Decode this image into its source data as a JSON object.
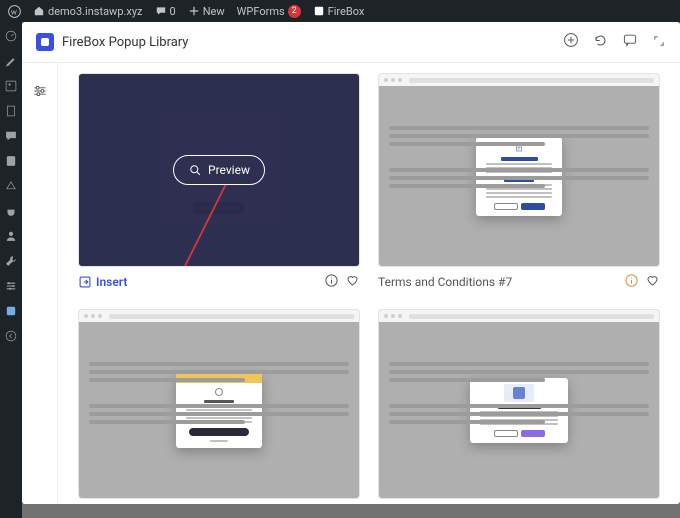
{
  "wpbar": {
    "site": "demo3.instawp.xyz",
    "comments": "0",
    "new": "New",
    "wpforms": "WPForms",
    "wpforms_count": "2",
    "firebox": "FireBox"
  },
  "modal": {
    "title": "FireBox Popup Library"
  },
  "grid": {
    "card1": {
      "preview_label": "Preview",
      "insert_label": "Insert"
    },
    "card2": {
      "title": "Terms and Conditions #7"
    }
  }
}
